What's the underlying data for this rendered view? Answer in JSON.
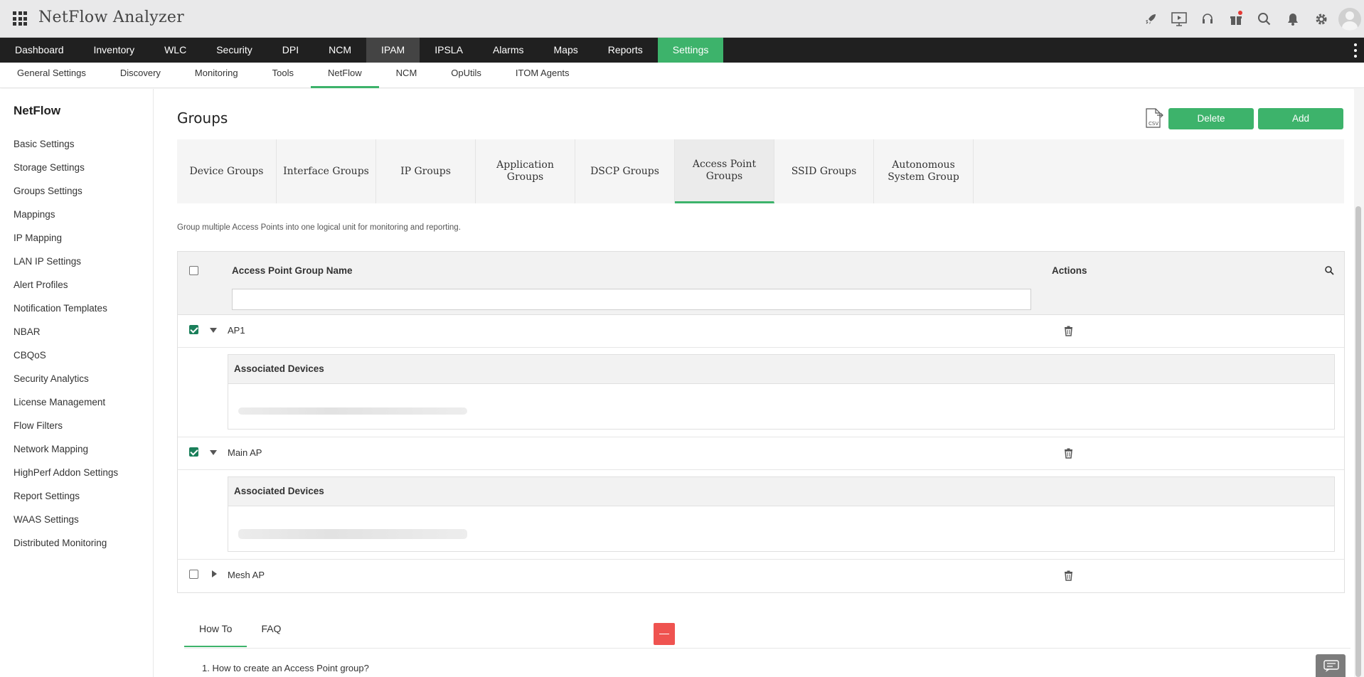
{
  "app": {
    "title": "NetFlow Analyzer"
  },
  "top_icons": [
    "rocket-icon",
    "presentation-icon",
    "headset-icon",
    "gift-icon",
    "search-icon",
    "bell-icon",
    "gear-icon"
  ],
  "main_nav": [
    {
      "label": "Dashboard"
    },
    {
      "label": "Inventory"
    },
    {
      "label": "WLC"
    },
    {
      "label": "Security"
    },
    {
      "label": "DPI"
    },
    {
      "label": "NCM"
    },
    {
      "label": "IPAM"
    },
    {
      "label": "IPSLA"
    },
    {
      "label": "Alarms"
    },
    {
      "label": "Maps"
    },
    {
      "label": "Reports"
    },
    {
      "label": "Settings"
    }
  ],
  "sub_nav": [
    {
      "label": "General Settings"
    },
    {
      "label": "Discovery"
    },
    {
      "label": "Monitoring"
    },
    {
      "label": "Tools"
    },
    {
      "label": "NetFlow"
    },
    {
      "label": "NCM"
    },
    {
      "label": "OpUtils"
    },
    {
      "label": "ITOM Agents"
    }
  ],
  "sidebar": {
    "title": "NetFlow",
    "items": [
      "Basic Settings",
      "Storage Settings",
      "Groups Settings",
      "Mappings",
      "IP Mapping",
      "LAN IP Settings",
      "Alert Profiles",
      "Notification Templates",
      "NBAR",
      "CBQoS",
      "Security Analytics",
      "License Management",
      "Flow Filters",
      "Network Mapping",
      "HighPerf Addon Settings",
      "Report Settings",
      "WAAS Settings",
      "Distributed Monitoring"
    ]
  },
  "page": {
    "title": "Groups",
    "csv_label": "CSV",
    "delete_label": "Delete",
    "add_label": "Add",
    "description": "Group multiple Access Points into one logical unit for monitoring and reporting."
  },
  "tabs": [
    {
      "label": "Device Groups"
    },
    {
      "label": "Interface Groups"
    },
    {
      "label": "IP Groups"
    },
    {
      "label": "Application Groups"
    },
    {
      "label": "DSCP Groups"
    },
    {
      "label": "Access Point Groups"
    },
    {
      "label": "SSID Groups"
    },
    {
      "label": "Autonomous System Group"
    }
  ],
  "active_tab": "Access Point Groups",
  "table": {
    "col_name": "Access Point Group Name",
    "col_actions": "Actions",
    "filter_value": "",
    "rows": [
      {
        "name": "AP1",
        "checked": true,
        "expanded": true,
        "detail_header": "Associated Devices"
      },
      {
        "name": "Main AP",
        "checked": true,
        "expanded": true,
        "detail_header": "Associated Devices"
      },
      {
        "name": "Mesh AP",
        "checked": false,
        "expanded": false
      }
    ]
  },
  "help": {
    "tabs": [
      {
        "label": "How To"
      },
      {
        "label": "FAQ"
      }
    ],
    "first_question": "1. How to create an Access Point group?"
  },
  "colors": {
    "accent": "#3db36b",
    "nav_bg": "#202020",
    "danger": "#ef5350"
  }
}
